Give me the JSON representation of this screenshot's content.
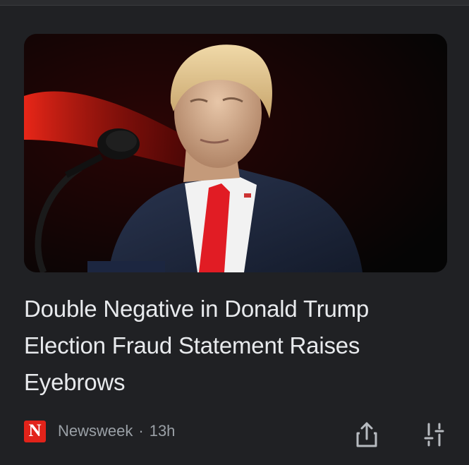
{
  "article": {
    "image_alt": "Donald Trump speaking at a microphone",
    "headline": "Double Negative in Donald Trump Election Fraud Statement Raises Eyebrows",
    "source": {
      "logo_letter": "N",
      "name": "Newsweek",
      "separator": "·",
      "time": "13h"
    }
  },
  "actions": {
    "share_icon": "share-icon",
    "tune_icon": "tune-icon"
  },
  "colors": {
    "background": "#202124",
    "headline": "#e8eaed",
    "meta": "#9aa0a6",
    "logo_red": "#e2231a"
  }
}
